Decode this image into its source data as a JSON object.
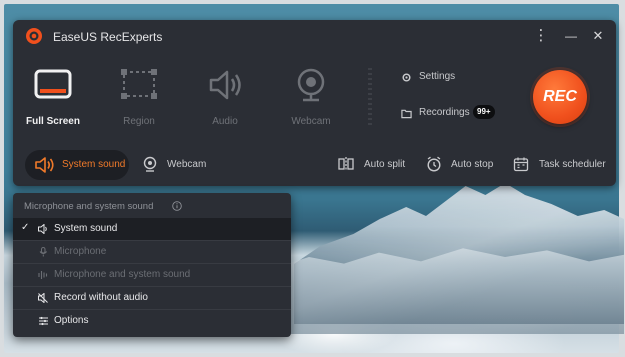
{
  "app": {
    "title": "EaseUS RecExperts",
    "accent": "#f0501d"
  },
  "window_controls": {
    "more": "⋮",
    "minimize": "—",
    "close": "✕"
  },
  "modes": [
    {
      "label": "Full Screen",
      "icon": "full-screen-icon",
      "active": true
    },
    {
      "label": "Region",
      "icon": "region-icon",
      "active": false
    },
    {
      "label": "Audio",
      "icon": "audio-icon",
      "active": false
    },
    {
      "label": "Webcam",
      "icon": "webcam-icon",
      "active": false
    }
  ],
  "side_links": {
    "settings": "Settings",
    "recordings": "Recordings",
    "recordings_badge": "99+"
  },
  "rec_button": "REC",
  "bottom_bar": {
    "system_sound": "System sound",
    "webcam": "Webcam",
    "auto_split": "Auto split",
    "auto_stop": "Auto stop",
    "task_scheduler": "Task scheduler"
  },
  "audio_menu": {
    "header": "Microphone and system sound",
    "items": [
      {
        "label": "System sound",
        "checked": true,
        "enabled": true,
        "icon": "speaker-icon"
      },
      {
        "label": "Microphone",
        "checked": false,
        "enabled": false,
        "icon": "microphone-icon"
      },
      {
        "label": "Microphone and system sound",
        "checked": false,
        "enabled": false,
        "icon": "mic-and-system-icon"
      },
      {
        "label": "Record without audio",
        "checked": false,
        "enabled": true,
        "icon": "muted-speaker-icon"
      },
      {
        "label": "Options",
        "checked": false,
        "enabled": true,
        "icon": "options-icon"
      }
    ]
  }
}
